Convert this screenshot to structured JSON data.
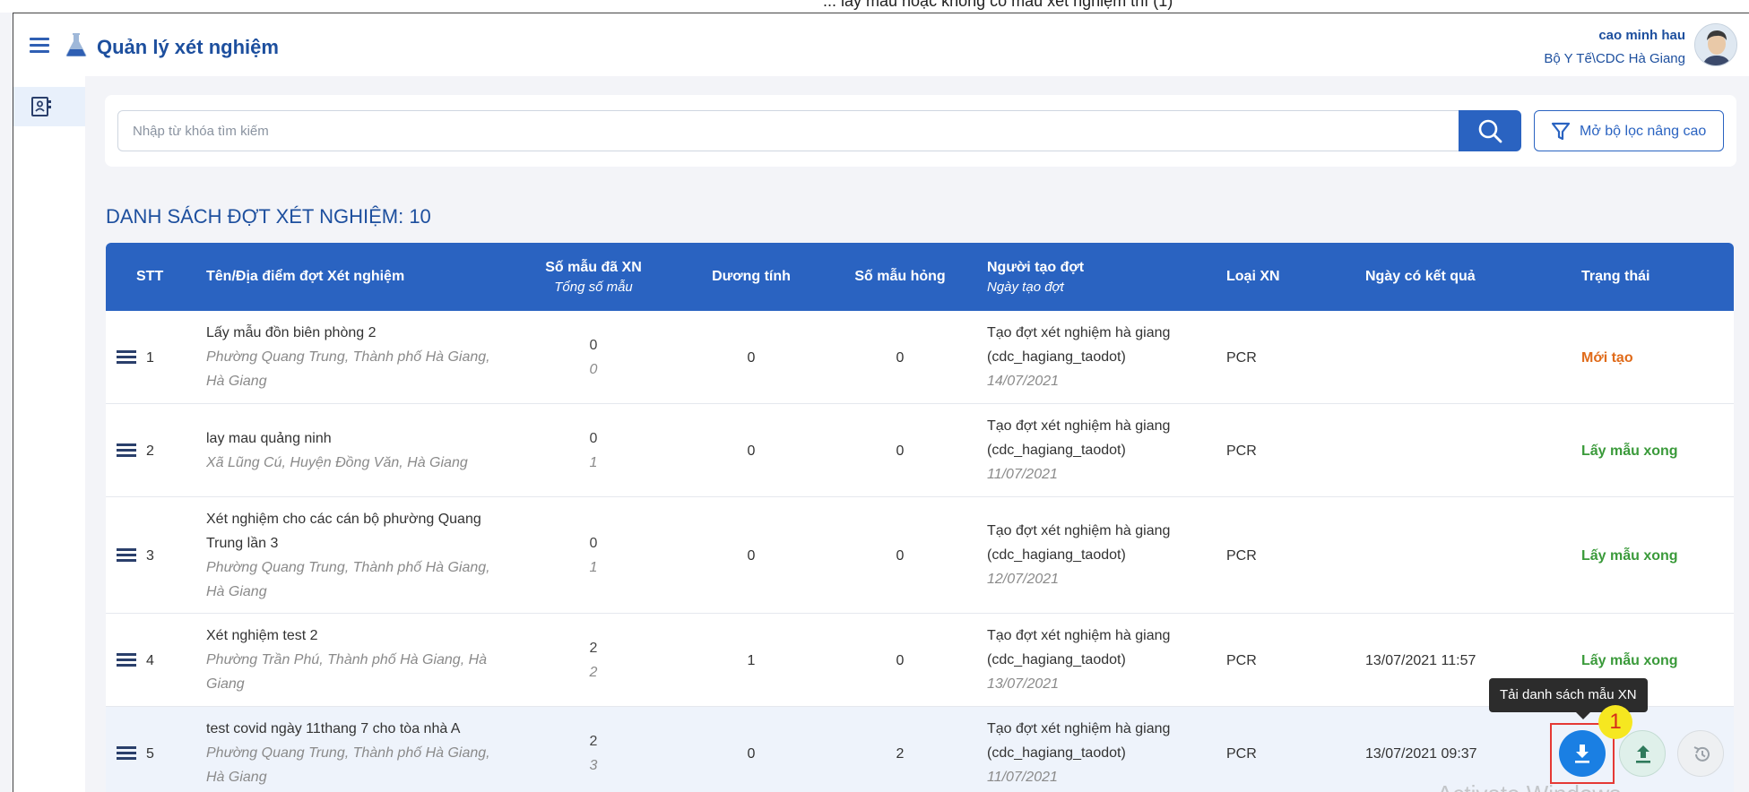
{
  "caption_top": "... lấy mẫu hoặc không có mẫu xét nghiệm thì (1)",
  "header": {
    "app_title": "Quản lý xét nghiệm",
    "user_name": "cao minh hau",
    "user_org": "Bộ Y Tế\\CDC Hà Giang"
  },
  "search": {
    "placeholder": "Nhập từ khóa tìm kiếm",
    "value": "",
    "advanced_filter_label": "Mở bộ lọc nâng cao"
  },
  "list": {
    "title": "DANH SÁCH ĐỢT XÉT NGHIỆM: 10"
  },
  "table": {
    "headers": {
      "stt": "STT",
      "name": "Tên/Địa điểm đợt Xét nghiệm",
      "tested": "Số mẫu đã XN",
      "total": "Tổng số mẫu",
      "positive": "Dương tính",
      "broken": "Số mẫu hỏng",
      "creator": "Người tạo đợt",
      "created_date": "Ngày tạo đợt",
      "type": "Loại XN",
      "result_date": "Ngày có kết quả",
      "status": "Trạng thái"
    },
    "rows": [
      {
        "stt": "1",
        "name": "Lấy mẫu đồn biên phòng 2",
        "address": "Phường Quang Trung, Thành phố Hà Giang, Hà Giang",
        "tested": "0",
        "total": "0",
        "positive": "0",
        "broken": "0",
        "creator": "Tạo đợt xét nghiệm hà giang",
        "creator_id": "(cdc_hagiang_taodot)",
        "created_date": "14/07/2021",
        "type": "PCR",
        "result_date": "",
        "status": "Mới tạo"
      },
      {
        "stt": "2",
        "name": "lay mau quảng ninh",
        "address": "Xã Lũng Cú, Huyện Đồng Văn, Hà Giang",
        "tested": "0",
        "total": "1",
        "positive": "0",
        "broken": "0",
        "creator": "Tạo đợt xét nghiệm hà giang",
        "creator_id": "(cdc_hagiang_taodot)",
        "created_date": "11/07/2021",
        "type": "PCR",
        "result_date": "",
        "status": "Lấy mẫu xong"
      },
      {
        "stt": "3",
        "name": "Xét nghiệm cho các cán bộ phường Quang Trung lần 3",
        "address": "Phường Quang Trung, Thành phố Hà Giang, Hà Giang",
        "tested": "0",
        "total": "1",
        "positive": "0",
        "broken": "0",
        "creator": "Tạo đợt xét nghiệm hà giang",
        "creator_id": "(cdc_hagiang_taodot)",
        "created_date": "12/07/2021",
        "type": "PCR",
        "result_date": "",
        "status": "Lấy mẫu xong"
      },
      {
        "stt": "4",
        "name": "Xét nghiệm test 2",
        "address": "Phường Trần Phú, Thành phố Hà Giang, Hà Giang",
        "tested": "2",
        "total": "2",
        "positive": "1",
        "broken": "0",
        "creator": "Tạo đợt xét nghiệm hà giang",
        "creator_id": "(cdc_hagiang_taodot)",
        "created_date": "13/07/2021",
        "type": "PCR",
        "result_date": "13/07/2021 11:57",
        "status": "Lấy mẫu xong"
      },
      {
        "stt": "5",
        "name": "test covid ngày 11thang 7 cho tòa nhà A",
        "address": "Phường Quang Trung, Thành phố Hà Giang, Hà Giang",
        "tested": "2",
        "total": "3",
        "positive": "0",
        "broken": "2",
        "creator": "Tạo đợt xét nghiệm hà giang",
        "creator_id": "(cdc_hagiang_taodot)",
        "created_date": "11/07/2021",
        "type": "PCR",
        "result_date": "13/07/2021 09:37",
        "status": ""
      }
    ]
  },
  "actions": {
    "tooltip": "Tải danh sách mẫu XN",
    "badge": "1"
  },
  "watermark": "Activate Windows",
  "colors": {
    "primary": "#2a63c1",
    "status_new": "#e06b1a",
    "status_done": "#3a9a3a",
    "download_button": "#1a7fe3"
  }
}
